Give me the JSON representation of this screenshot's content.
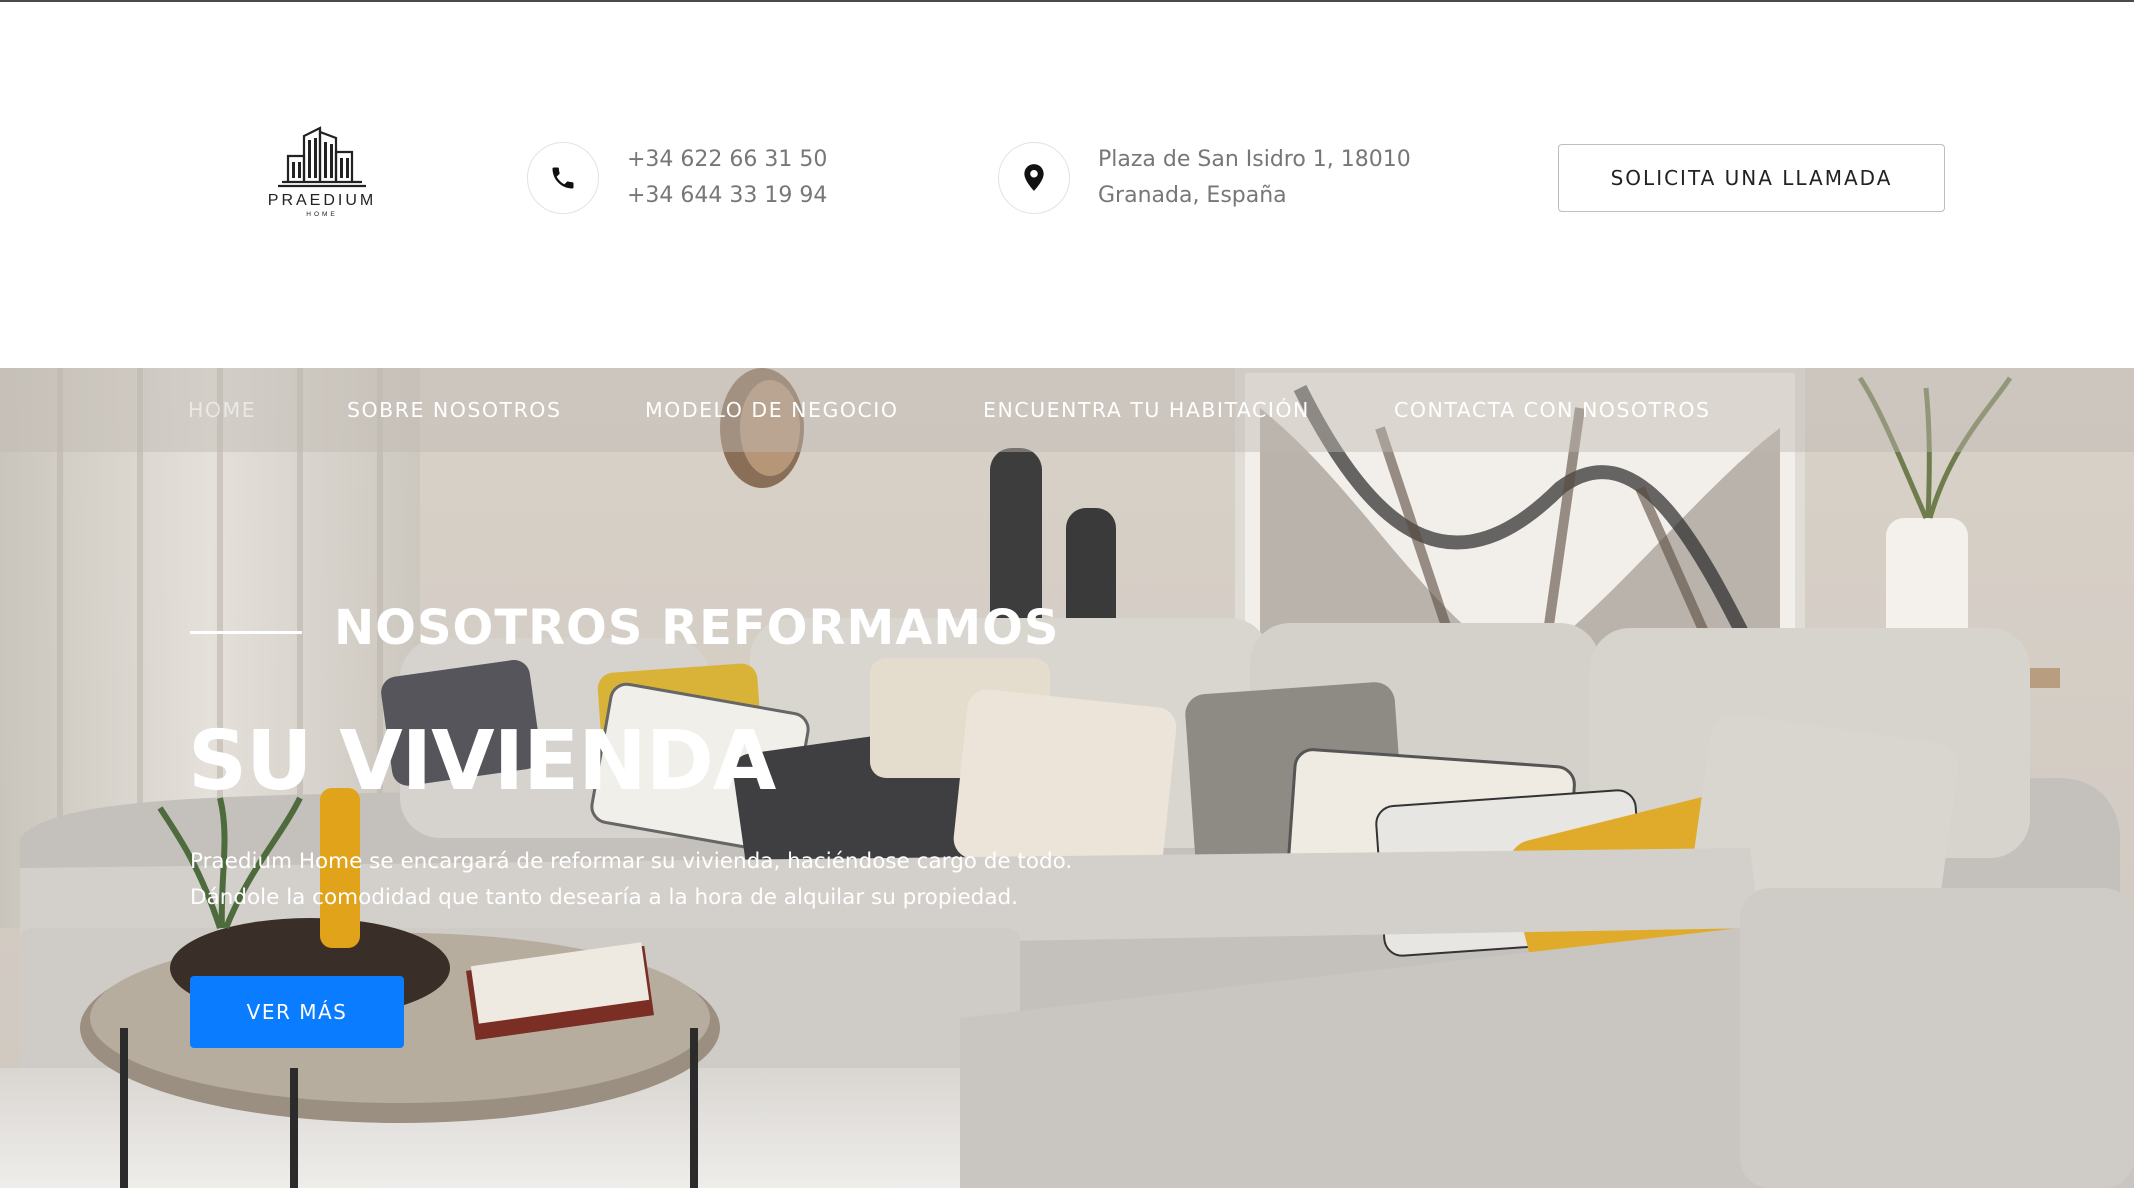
{
  "brand": {
    "name": "PRAEDIUM",
    "subtitle": "HOME"
  },
  "header": {
    "phones": [
      "+34 622 66 31 50",
      "+34 644 33 19 94"
    ],
    "address": [
      "Plaza de San Isidro 1, 18010",
      "Granada, España"
    ],
    "call_button": "SOLICITA UNA LLAMADA"
  },
  "nav": {
    "items": [
      {
        "label": "HOME",
        "active": true
      },
      {
        "label": "SOBRE NOSOTROS",
        "active": false
      },
      {
        "label": "MODELO DE NEGOCIO",
        "active": false
      },
      {
        "label": "ENCUENTRA TU HABITACIÓN",
        "active": false
      },
      {
        "label": "CONTACTA CON NOSOTROS",
        "active": false
      }
    ]
  },
  "hero": {
    "kicker": "NOSOTROS REFORMAMOS",
    "headline": "SU VIVIENDA",
    "lead": [
      "Praedium Home se encargará de reformar su vivienda, haciéndose cargo de todo.",
      "Dándole la comodidad que tanto desearía a la hora de alquilar su propiedad."
    ],
    "cta": "VER MÁS"
  },
  "colors": {
    "accent": "#0a7cff",
    "header_bg": "#ffffff",
    "text_muted": "#777777"
  },
  "icons": {
    "phone": "phone-icon",
    "location": "location-pin-icon",
    "logo": "building-logo-icon"
  }
}
